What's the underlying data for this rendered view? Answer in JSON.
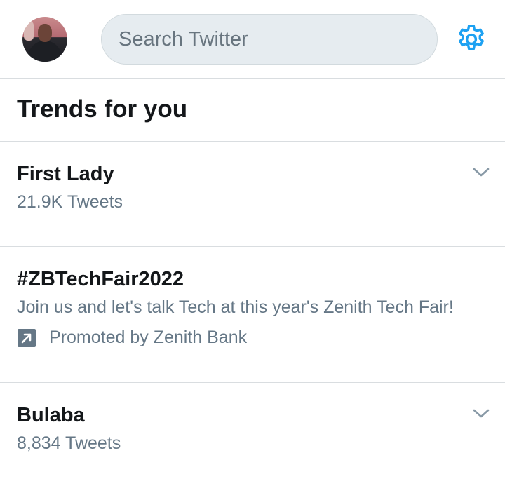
{
  "search": {
    "placeholder": "Search Twitter"
  },
  "section": {
    "title": "Trends for you"
  },
  "trends": [
    {
      "name": "First Lady",
      "count": "21.9K Tweets"
    },
    {
      "name": "#ZBTechFair2022",
      "description": "Join us and let's talk Tech at this year's Zenith Tech Fair!",
      "promoted": "Promoted by Zenith Bank"
    },
    {
      "name": "Bulaba",
      "count": "8,834 Tweets"
    }
  ],
  "colors": {
    "accent": "#1da1f2",
    "secondary_text": "#657786",
    "divider": "#d9dde0"
  },
  "icons": {
    "settings": "gear-icon",
    "more": "chevron-down-icon",
    "promoted": "promoted-arrow-icon"
  }
}
